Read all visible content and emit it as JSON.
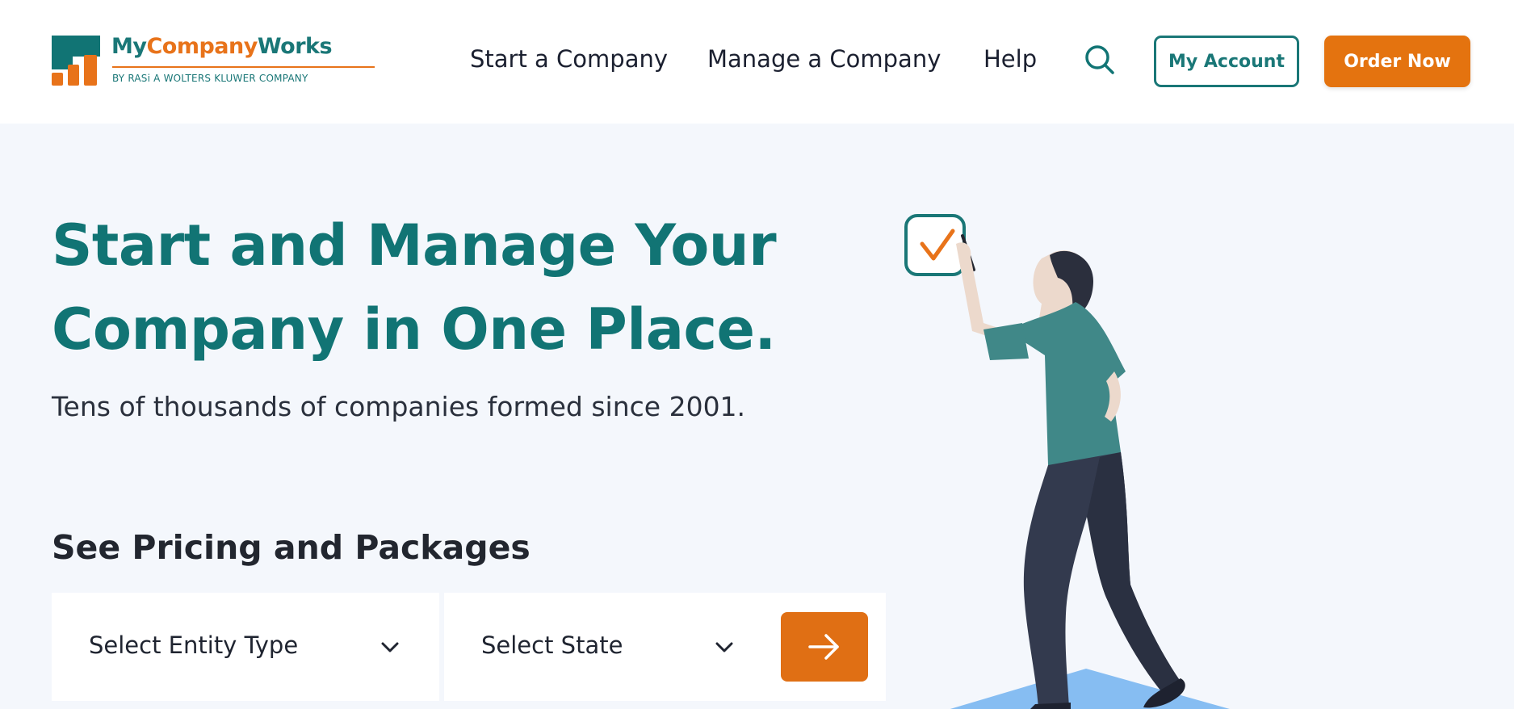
{
  "brand": {
    "name_part1": "My",
    "name_part2": "Company",
    "name_part3": "Works",
    "tagline": "BY RASi A WOLTERS KLUWER COMPANY",
    "colors": {
      "teal": "#117474",
      "orange": "#e4730f",
      "background": "#f4f7fc"
    }
  },
  "nav": {
    "items": [
      {
        "label": "Start a Company"
      },
      {
        "label": "Manage a Company"
      },
      {
        "label": "Help"
      }
    ],
    "search_icon": "search-icon",
    "account_label": "My Account",
    "order_label": "Order Now"
  },
  "hero": {
    "title_line1": "Start and Manage Your",
    "title_line2": "Company in One Place.",
    "subtitle": "Tens of thousands of companies formed since 2001."
  },
  "pricing": {
    "heading": "See Pricing and Packages",
    "entity_select": {
      "label": "Select Entity Type",
      "icon": "chevron-down-icon"
    },
    "state_select": {
      "label": "Select State",
      "icon": "chevron-down-icon"
    },
    "submit_icon": "arrow-right-icon"
  }
}
